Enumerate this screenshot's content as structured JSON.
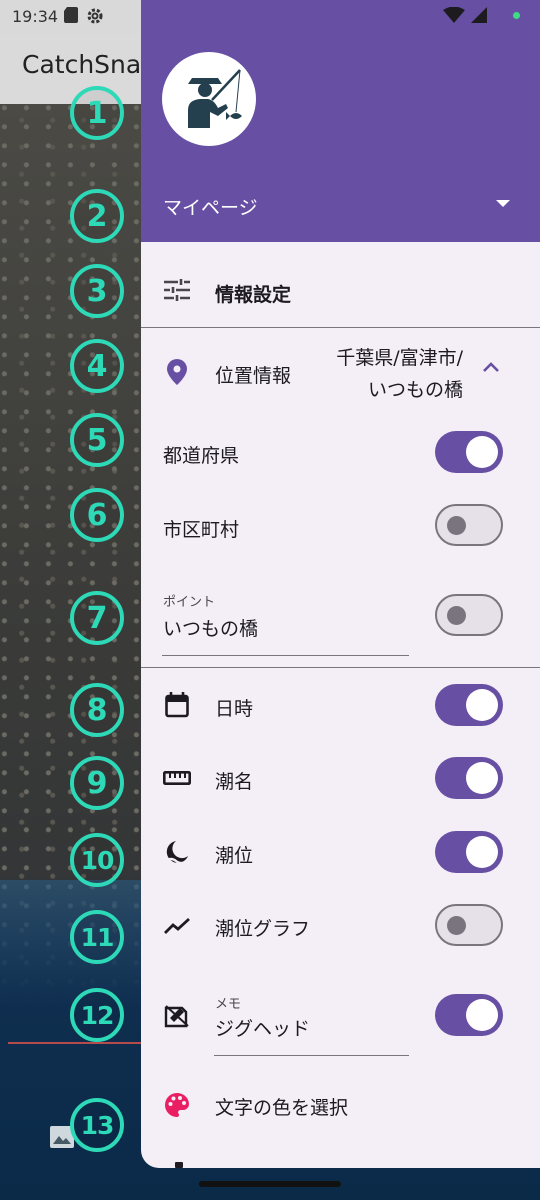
{
  "status_bar": {
    "time": "19:34"
  },
  "background_app": {
    "title": "CatchSna"
  },
  "markers": [
    "1",
    "2",
    "3",
    "4",
    "5",
    "6",
    "7",
    "8",
    "9",
    "10",
    "11",
    "12",
    "13"
  ],
  "drawer": {
    "header": {
      "label": "マイページ"
    },
    "info_settings": {
      "label": "情報設定"
    },
    "location": {
      "label": "位置情報",
      "value_line1": "千葉県/富津市/",
      "value_line2": "いつもの橋",
      "expanded": true
    },
    "prefecture": {
      "label": "都道府県",
      "on": true
    },
    "city": {
      "label": "市区町村",
      "on": false
    },
    "point": {
      "caption": "ポイント",
      "value": "いつもの橋",
      "on": false
    },
    "datetime": {
      "label": "日時",
      "on": true
    },
    "tide_name": {
      "label": "潮名",
      "on": true
    },
    "tide_level": {
      "label": "潮位",
      "on": true
    },
    "tide_graph": {
      "label": "潮位グラフ",
      "on": false
    },
    "memo": {
      "caption": "メモ",
      "value": "ジグヘッド",
      "on": true
    },
    "text_color": {
      "label": "文字の色を選択"
    }
  },
  "colors": {
    "primary": "#6750a4",
    "marker": "#2dd9b7",
    "drawer_bg": "#f4eff6",
    "palette_icon": "#e91e63"
  },
  "icons": [
    "sd-card-icon",
    "settings-icon",
    "wifi-icon",
    "signal-icon",
    "tune-icon",
    "location-pin-icon",
    "chevron-up-icon",
    "calendar-icon",
    "ruler-icon",
    "moon-icon",
    "trend-graph-icon",
    "edit-note-icon",
    "palette-icon",
    "image-icon"
  ]
}
